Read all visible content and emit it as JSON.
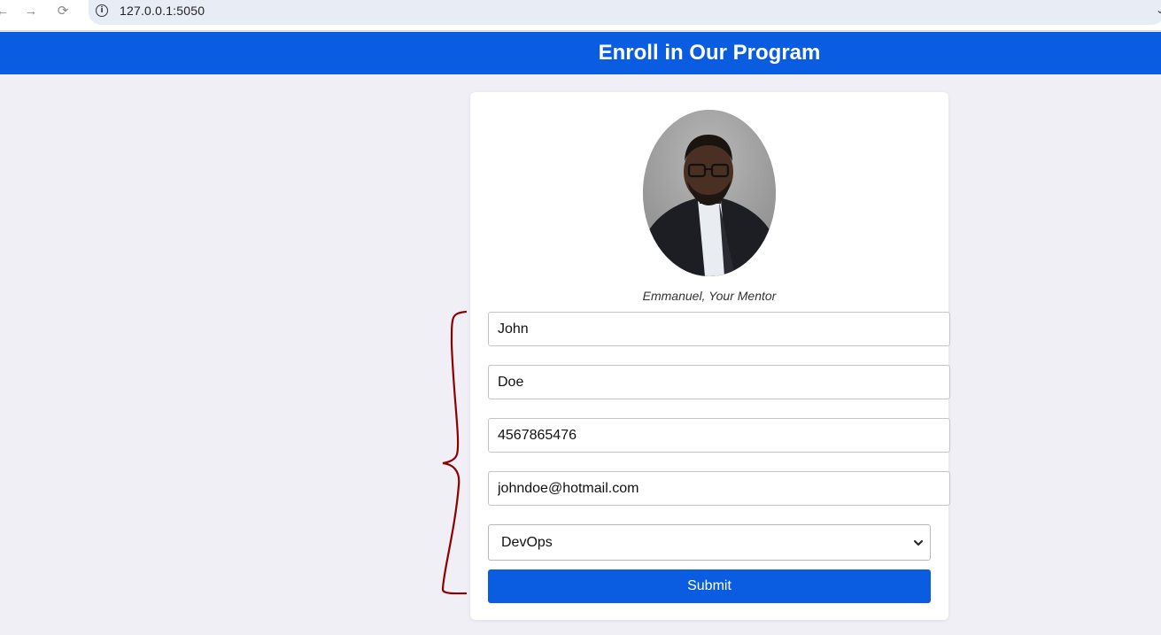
{
  "browser": {
    "url": "127.0.0.1:5050",
    "back_icon": "back-arrow-icon",
    "forward_icon": "forward-arrow-icon",
    "reload_icon": "reload-icon",
    "info_icon": "info-icon"
  },
  "header": {
    "title": "Enroll in Our Program",
    "color": "#0a5ce0"
  },
  "mentor": {
    "caption": "Emmanuel, Your Mentor"
  },
  "form": {
    "first_name": "John",
    "last_name": "Doe",
    "phone": "4567865476",
    "email": "johndoe@hotmail.com",
    "program": "DevOps",
    "submit_label": "Submit"
  }
}
